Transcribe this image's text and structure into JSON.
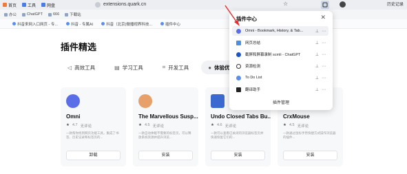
{
  "browser": {
    "tabs": [
      {
        "label": "首页",
        "color": "#f07a3a"
      },
      {
        "label": "工具",
        "color": "#4a7de8"
      },
      {
        "label": "网盘",
        "color": "#4a7de8"
      }
    ],
    "url": "extensions.quark.cn",
    "history_label": "历史记录"
  },
  "bookmarks_row1": [
    {
      "label": "办公"
    },
    {
      "label": "ChatGPT"
    },
    {
      "label": "666"
    },
    {
      "label": "下载站"
    }
  ],
  "bookmarks_row2": [
    {
      "label": "抖音来网入口网页 - 专..."
    },
    {
      "label": "抖音 - 专属AI"
    },
    {
      "label": "抖音（北京)微播视界科技..."
    },
    {
      "label": "插件中心"
    }
  ],
  "page": {
    "heading": "插件精选",
    "categories": [
      {
        "label": "高效工具",
        "icon": "send-icon"
      },
      {
        "label": "学习工具",
        "icon": "book-icon"
      },
      {
        "label": "开发工具",
        "icon": "code-icon"
      },
      {
        "label": "体验优",
        "icon": "circle-icon"
      }
    ]
  },
  "cards": [
    {
      "title": "Omni",
      "rating": "4.7",
      "note": "无评论",
      "desc": "一款帮你找到网页功能工具，集成了书签、历史记录和标签页的...",
      "button": "卸载",
      "logo_color": "#5a6ee8"
    },
    {
      "title": "The Marvellous Susp...",
      "rating": "4.5",
      "note": "无评论",
      "desc": "一款自动休眠不需要的标签页，可以释放系统资源并提升浏览...",
      "button": "安装",
      "logo_color": "#e8a06a"
    },
    {
      "title": "Undo Closed Tabs Bu...",
      "rating": "4.6",
      "note": "无评论",
      "desc": "一款可以查看已关闭的浏览器标签页并快速恢复它们的...",
      "button": "安装",
      "logo_color": "#3a6ad0"
    },
    {
      "title": "CrxMouse",
      "rating": "4.5",
      "note": "无评论",
      "desc": "一款通过鼠标手势快捷方式操作浏览器的插件...",
      "button": "安装",
      "logo_color": "#4a8ce8"
    }
  ],
  "popup": {
    "title": "插件中心",
    "items": [
      {
        "label": "Omni - Bookmark, History, & Tab...",
        "color": "#5a6ee8"
      },
      {
        "label": "网页总结",
        "color": "#4a90e2"
      },
      {
        "label": "截屏和屏幕录制 scmli - ChatGPT",
        "color": "#1a56c8"
      },
      {
        "label": "资源检测",
        "color": "#333333"
      },
      {
        "label": "To Do List",
        "color": "#5a8dee"
      },
      {
        "label": "翻译助手",
        "color": "#222222"
      }
    ],
    "manage": "插件管理"
  }
}
